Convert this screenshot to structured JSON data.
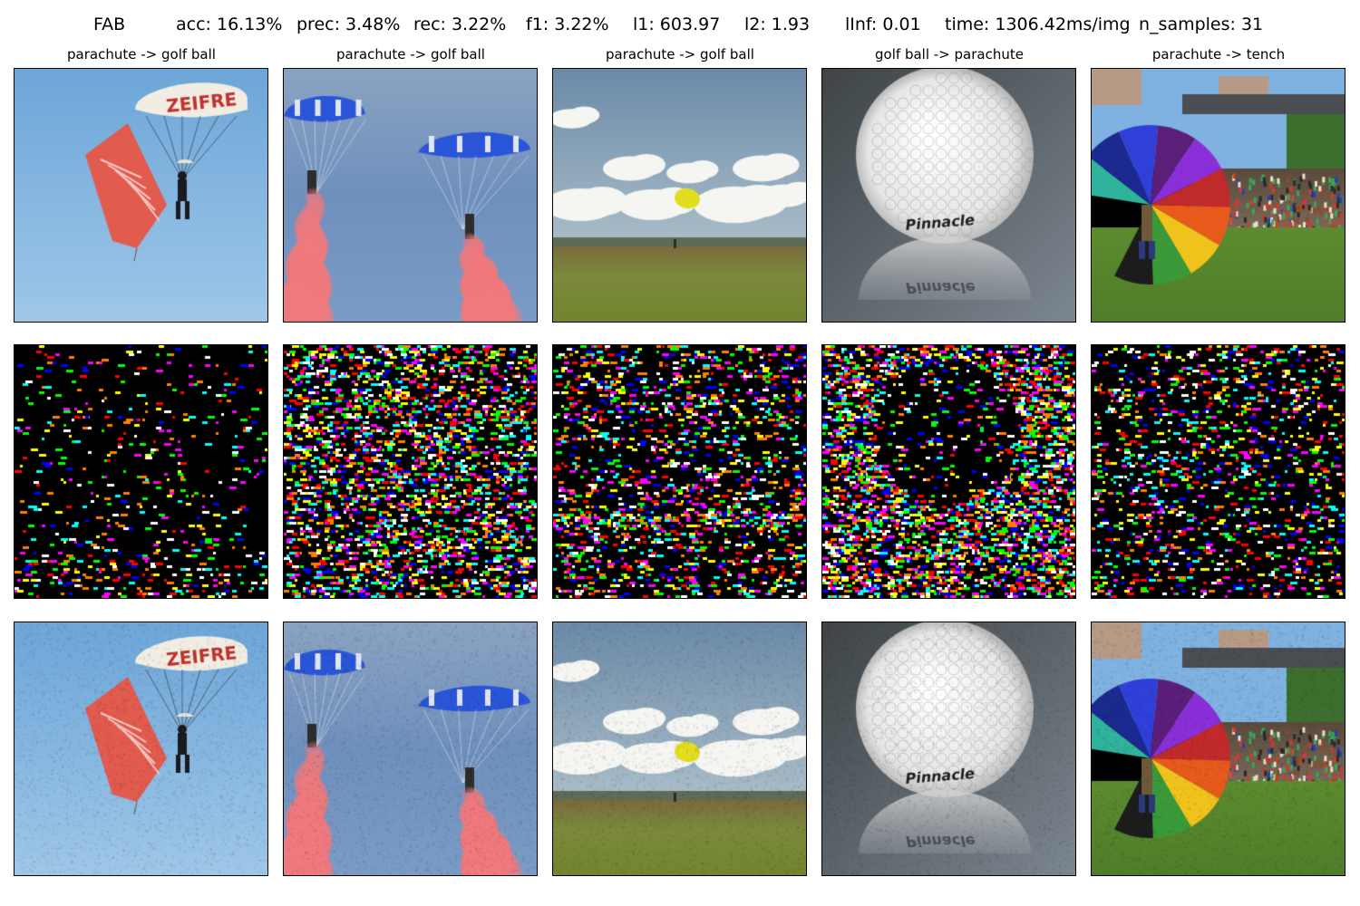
{
  "figure": {
    "attack_name": "FAB",
    "metrics": [
      "acc: 16.13%",
      "prec: 3.48%",
      "rec: 3.22%",
      "f1: 3.22%",
      "l1: 603.97",
      "l2: 1.93",
      "lInf: 0.01",
      "time: 1306.42ms/img",
      "n_samples: 31"
    ]
  },
  "columns": [
    {
      "title": "parachute -> golf ball",
      "scene": "red-parachute-sky"
    },
    {
      "title": "parachute -> golf ball",
      "scene": "blue-parachutes-smoke"
    },
    {
      "title": "parachute -> golf ball",
      "scene": "yellow-parachute-field"
    },
    {
      "title": "golf ball -> parachute",
      "scene": "golf-ball-closeup"
    },
    {
      "title": "parachute -> tench",
      "scene": "rainbow-parachute-crowd"
    }
  ],
  "rows": [
    {
      "role": "original-image"
    },
    {
      "role": "perturbation-map"
    },
    {
      "role": "adversarial-image"
    }
  ],
  "colors": {
    "sky_blue": "#7fb2dc",
    "parachute_red": "#e25b4f",
    "canopy_blue": "#2a55d8",
    "smoke_pink": "#f07a7e",
    "field_green": "#7b8a3c",
    "ball_white": "#f3f3f3"
  }
}
